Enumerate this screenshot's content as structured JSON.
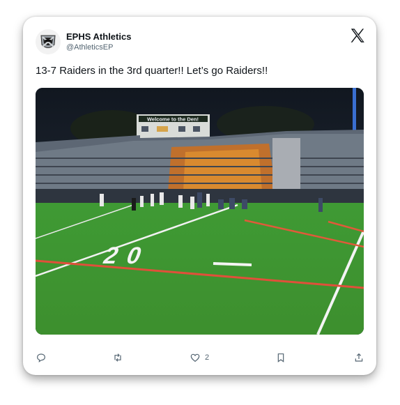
{
  "tweet": {
    "author_name": "EPHS Athletics",
    "author_handle": "@AthleticsEP",
    "text": "13-7 Raiders in the 3rd quarter!! Let’s go Raiders!!",
    "media": {
      "scoreboard_sign": "Welcome to the Den!",
      "field_number": "20"
    }
  },
  "icons": {
    "brand": "x-logo-icon",
    "reply": "reply-icon",
    "retweet": "retweet-icon",
    "like": "heart-icon",
    "bookmark": "bookmark-icon",
    "share": "share-icon"
  },
  "actions": {
    "like_count": "2"
  },
  "colors": {
    "text": "#0f1419",
    "secondary": "#536471",
    "turf": "#3f9e35"
  }
}
